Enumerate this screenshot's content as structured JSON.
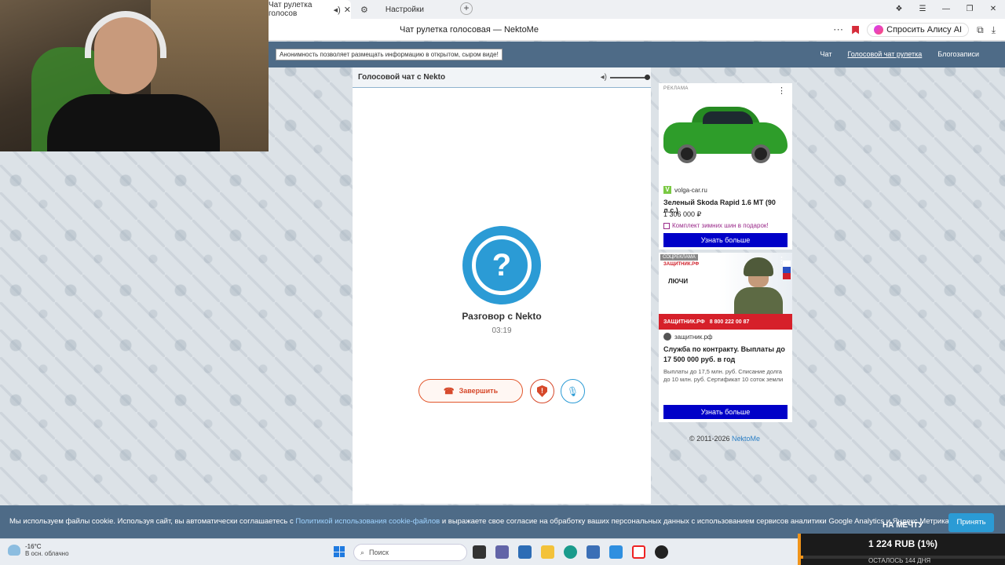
{
  "browser": {
    "tabs": [
      {
        "label": "Чат рулетка голосов",
        "active": true
      },
      {
        "label": "Настройки",
        "active": false
      }
    ],
    "page_title": "Чат рулетка голосовая — NektoMe",
    "alisa_button": "Спросить Алису AI"
  },
  "site": {
    "notice": "Анонимность позволяет размещать информацию в открытом, сыром виде!",
    "nav": [
      "Чат",
      "Голосовой чат рулетка",
      "Блогозаписи"
    ]
  },
  "chat": {
    "header_title": "Голосовой чат с Nekto",
    "volume_level": 1.0,
    "avatar_glyph": "?",
    "talk_title": "Разговор с Nekto",
    "timer": "03:19",
    "end_button": "Завершить",
    "report_glyph": "!"
  },
  "ad1": {
    "label": "РЕКЛАМА",
    "source": "volga-car.ru",
    "title": "Зеленый Skoda Rapid 1.6 MT (90 л.с.)",
    "price": "1 306 000 ₽",
    "promo": "Комплект зимних шин в подарок!",
    "button": "Узнать больше"
  },
  "ad2": {
    "label": "СОЦРЕКЛАМА",
    "brand_small": "ЗАЩИТНИК.РФ",
    "banner_word": "ЛЮЧИ",
    "strip_brand": "ЗАЩИТНИК.РФ",
    "strip_phone": "8 800 222 00 87",
    "source": "защитник.рф",
    "title": "Служба по контракту. Выплаты до 17 500 000 руб. в год",
    "description": "Выплаты до 17,5 млн. руб. Списание долга до 10 млн. руб. Сертификат 10 соток земли",
    "button": "Узнать больше"
  },
  "footer": {
    "copyright": "© 2011-2026",
    "link": "NektoMe"
  },
  "cookie": {
    "text_before": "Мы используем файлы cookie. Используя сайт, вы автоматически соглашаетесь с",
    "link": "Политикой использования cookie-файлов",
    "text_after": "и выражаете свое согласие на обработку ваших персональных данных с использованием сервисов аналитики Google Analytics и Яндекс.Метрика.",
    "accept": "Принять"
  },
  "taskbar": {
    "temperature": "-16°C",
    "weather": "В осн. облачно",
    "search_placeholder": "Поиск"
  },
  "donation": {
    "goal": "НА МЕЧТУ",
    "amount": "1 224 RUB (1%)",
    "remaining": "ОСТАЛОСЬ 144 ДНЯ",
    "progress": 0.01
  },
  "colors": {
    "site_header": "#4e6b87",
    "accent_blue": "#2b9bd5",
    "end_red": "#d6482a",
    "ad_button": "#0000c8"
  }
}
